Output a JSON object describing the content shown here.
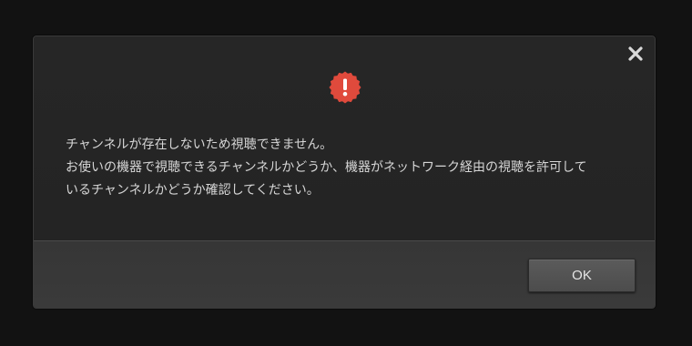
{
  "dialog": {
    "icons": {
      "close": "close-icon",
      "alert": "alert-icon"
    },
    "message_lines": [
      "チャンネルが存在しないため視聴できません。",
      "お使いの機器で視聴できるチャンネルかどうか、機器がネットワーク経由の視聴を許可して",
      "いるチャンネルかどうか確認してください。"
    ],
    "ok_label": "OK",
    "colors": {
      "alert_icon": "#e04a3c",
      "background": "#121212",
      "dialog": "#242424",
      "footer": "#383838",
      "text": "#d6d6d6"
    }
  }
}
